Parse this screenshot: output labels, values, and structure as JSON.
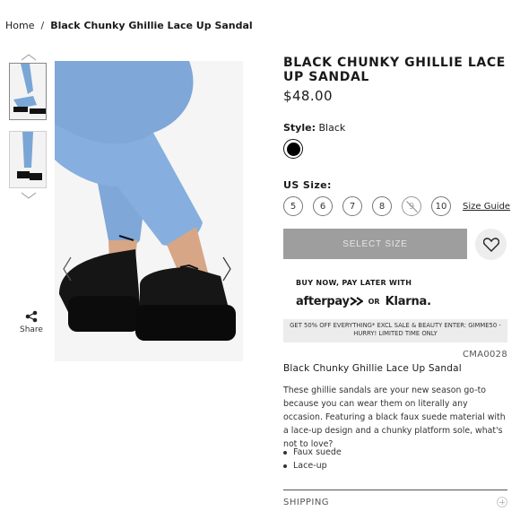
{
  "breadcrumb": {
    "home": "Home",
    "separator": "/",
    "current": "Black Chunky Ghillie Lace Up Sandal"
  },
  "gallery": {
    "thumbnails": [
      "sandal-thumbnail-1",
      "sandal-thumbnail-2"
    ],
    "share_label": "Share",
    "icons": {
      "prev": "chevron-left-icon",
      "next": "chevron-right-icon",
      "up": "chevron-up-icon",
      "down": "chevron-down-icon",
      "share": "share-icon"
    }
  },
  "product": {
    "title": "BLACK CHUNKY GHILLIE LACE UP SANDAL",
    "price": "$48.00",
    "style_label": "Style:",
    "style_value": "Black",
    "swatch_color": "#000000",
    "size_label": "US Size:",
    "sizes": [
      {
        "label": "5",
        "available": true
      },
      {
        "label": "6",
        "available": true
      },
      {
        "label": "7",
        "available": true
      },
      {
        "label": "8",
        "available": true
      },
      {
        "label": "9",
        "available": false
      },
      {
        "label": "10",
        "available": true
      }
    ],
    "size_guide": "Size Guide",
    "select_button": "SELECT SIZE",
    "wishlist_icon": "heart-icon",
    "bnpl_heading": "BUY NOW, PAY LATER WITH",
    "afterpay": "afterpay",
    "or": "OR",
    "klarna": "Klarna.",
    "promo": "GET 50% OFF EVERYTHING* EXCL SALE & BEAUTY ENTER: GIMME50 - HURRY! LIMITED TIME ONLY",
    "code": "CMA0028",
    "desc_title": "Black Chunky Ghillie Lace Up Sandal",
    "description": "These ghillie sandals are your new season go-to because you can wear them on literally any occasion. Featuring a black faux suede material with a lace-up design and a chunky platform sole, what's not to love?",
    "bullets": [
      "Faux suede",
      "Lace-up"
    ],
    "shipping_label": "SHIPPING"
  },
  "colors": {
    "button_disabled": "#9e9e9e",
    "promo_bg": "#ececec",
    "accent": "#000000"
  }
}
